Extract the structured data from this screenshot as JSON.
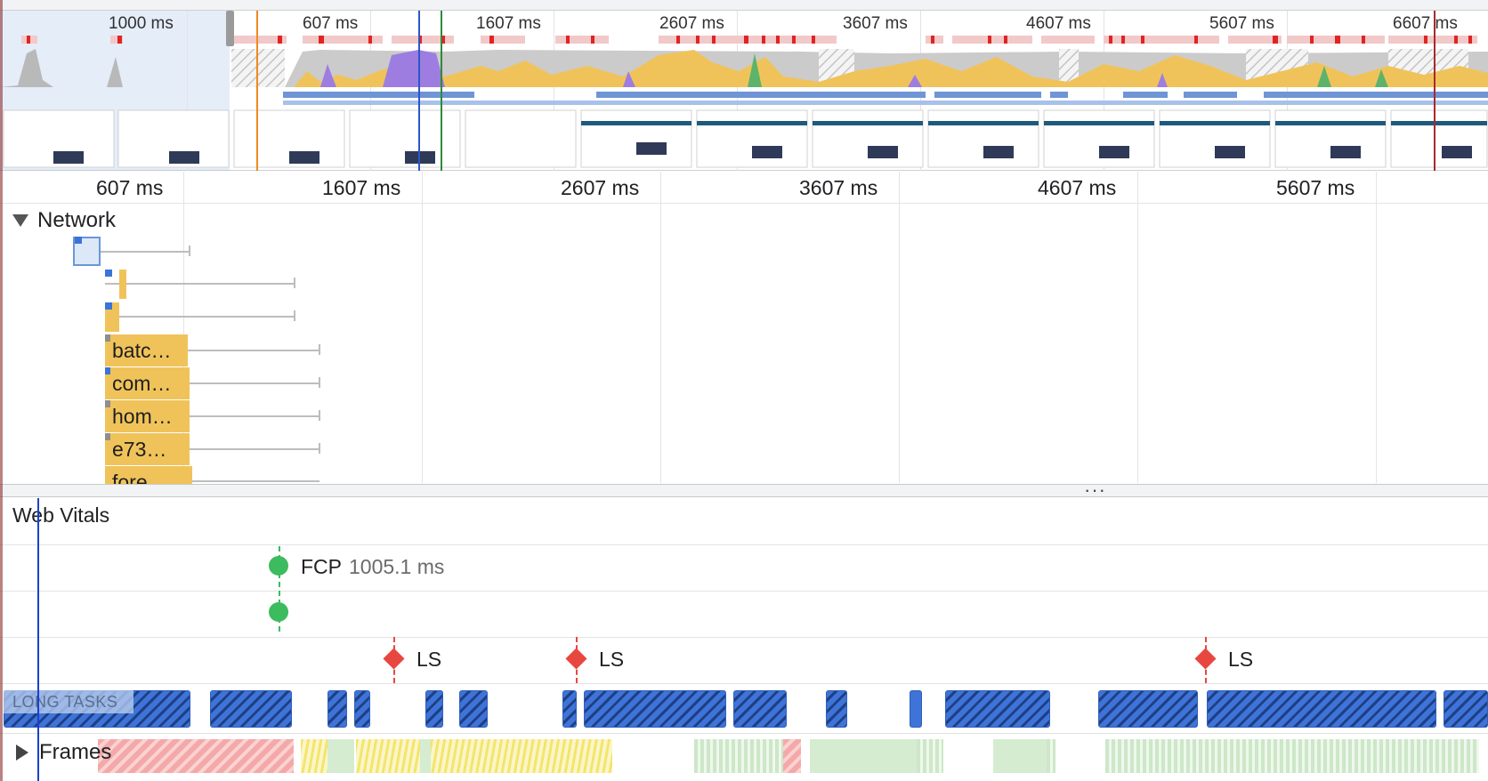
{
  "overview": {
    "tick_labels": [
      "1000 ms",
      "607 ms",
      "1607 ms",
      "2607 ms",
      "3607 ms",
      "4607 ms",
      "5607 ms",
      "6607 ms"
    ]
  },
  "ruler": {
    "labels": [
      "607 ms",
      "1607 ms",
      "2607 ms",
      "3607 ms",
      "4607 ms",
      "5607 ms"
    ]
  },
  "network": {
    "title": "Network",
    "requests": [
      "batc…",
      "com…",
      "hom…",
      "e73…",
      "fore…"
    ]
  },
  "web_vitals": {
    "title": "Web Vitals",
    "fcp_label": "FCP",
    "fcp_value": "1005.1 ms",
    "ls_labels": [
      "LS",
      "LS",
      "LS"
    ],
    "long_tasks_label": "LONG TASKS"
  },
  "frames": {
    "title": "Frames"
  },
  "colors": {
    "scripting": "#f0c35a",
    "rendering": "#9d7de0",
    "painting": "#5db36a",
    "idle": "#c8c8c8",
    "long_task": "#3e74d7",
    "fcp": "#3dbb5f",
    "layout_shift": "#e8473f"
  }
}
